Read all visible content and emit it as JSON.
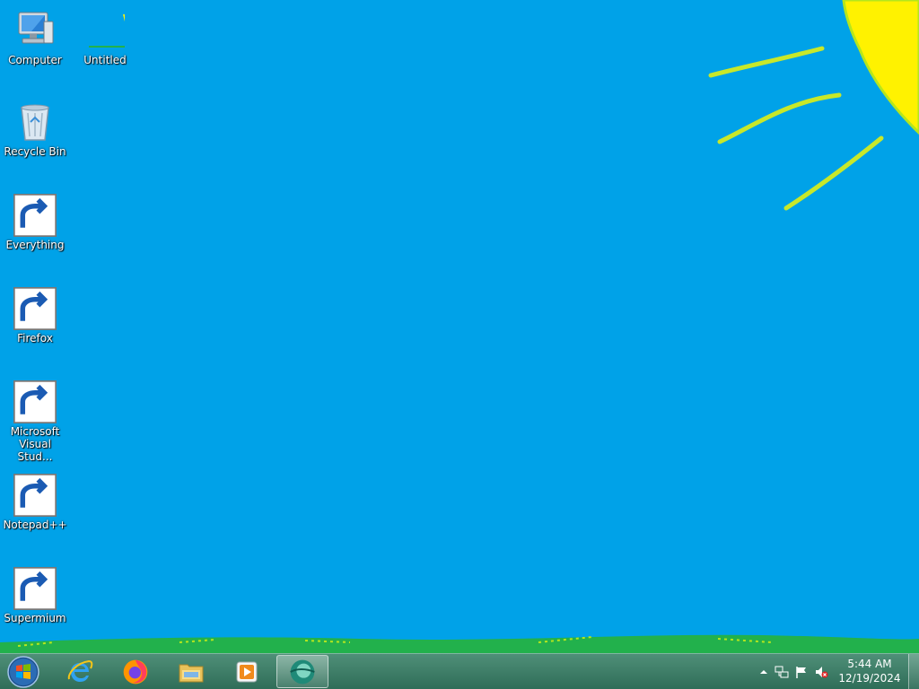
{
  "desktop": {
    "background_color": "#00a2e8",
    "icons": [
      {
        "label": "Computer",
        "icon": "computer-icon"
      },
      {
        "label": "Untitled",
        "icon": "image-file-icon"
      },
      {
        "label": "Recycle Bin",
        "icon": "recycle-bin-icon"
      },
      {
        "label": "Everything",
        "icon": "everything-icon",
        "shortcut": true
      },
      {
        "label": "Firefox",
        "icon": "firefox-icon",
        "shortcut": true
      },
      {
        "label": "Microsoft Visual Stud...",
        "icon": "visual-studio-icon",
        "shortcut": true
      },
      {
        "label": "Notepad++",
        "icon": "notepadpp-icon",
        "shortcut": true
      },
      {
        "label": "Supermium",
        "icon": "supermium-icon",
        "shortcut": true
      }
    ]
  },
  "taskbar": {
    "color": "#3a7d66",
    "pinned": [
      {
        "name": "internet-explorer",
        "icon": "ie-icon"
      },
      {
        "name": "firefox",
        "icon": "firefox-icon"
      },
      {
        "name": "file-explorer",
        "icon": "folder-icon"
      },
      {
        "name": "media-player",
        "icon": "media-player-icon"
      },
      {
        "name": "supermium",
        "icon": "supermium-icon",
        "active": true
      }
    ],
    "tray": {
      "icons": [
        "show-hidden-icons-icon",
        "network-icon",
        "action-center-flag-icon",
        "volume-muted-icon"
      ],
      "time": "5:44 AM",
      "date": "12/19/2024"
    }
  }
}
